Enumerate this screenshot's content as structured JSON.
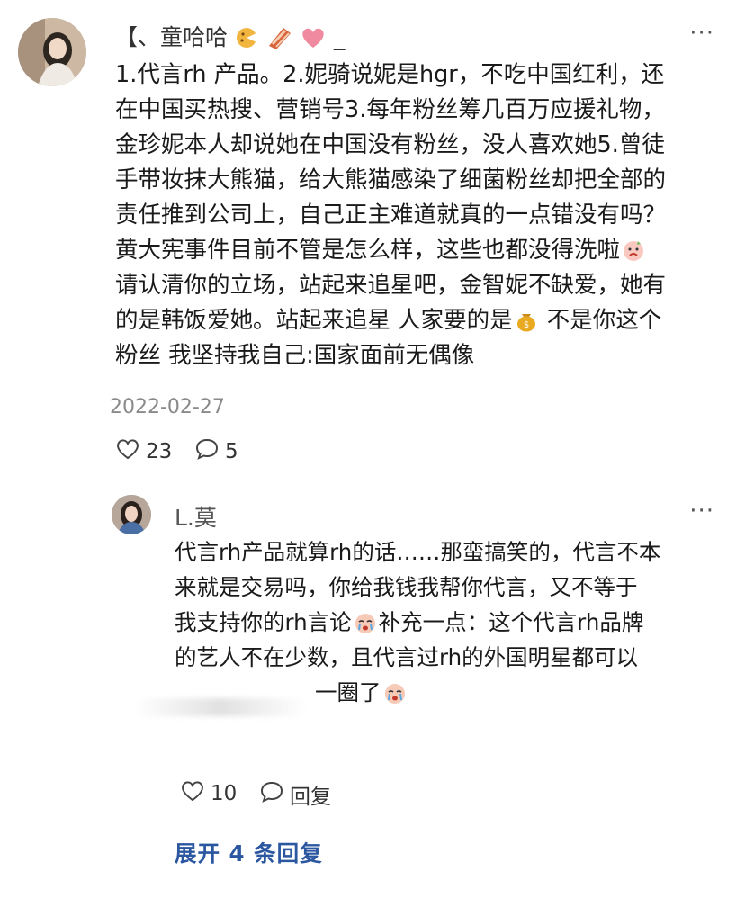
{
  "main_comment": {
    "username": "【、童哈哈",
    "username_suffix": "_",
    "username_emojis": [
      "cookie-icon",
      "bacon-icon",
      "heart-icon"
    ],
    "more_label": "···",
    "lines": [
      "1.代言rh 产品。2.妮骑说妮是hgr，不吃中国红利，还",
      "在中国买热搜、营销号3.每年粉丝筹几百万应援礼物，",
      "金珍妮本人却说她在中国没有粉丝，没人喜欢她5.曾徒",
      "手带妆抹大熊猫，给大熊猫感染了细菌粉丝却把全部的",
      "责任推到公司上，自己正主难道就真的一点错没有吗？",
      "黄大宪事件目前不管是怎么样，这些也都没得洗啦",
      "请认清你的立场，站起来追星吧，金智妮不缺爱，她有",
      "的是韩饭爱她。站起来追星 人家要的是",
      "粉丝 我坚持我自己:国家面前无偶像"
    ],
    "line8_tail": " 不是你这个",
    "date": "2022-02-27",
    "likes": "23",
    "replies": "5"
  },
  "reply": {
    "username": "L.莫",
    "more_label": "···",
    "lines": [
      "代言rh产品就算rh的话……那蛮搞笑的，代言不本",
      "来就是交易吗，你给我钱我帮你代言，又不等于",
      "我支持你的rh言论",
      "的艺人不在少数，且代言过rh的外国明星都可以",
      "一圈了"
    ],
    "line3_tail": "补充一点：这个代言rh品牌",
    "likes": "10",
    "reply_label": "回复"
  },
  "expand_label": "展开 4 条回复"
}
